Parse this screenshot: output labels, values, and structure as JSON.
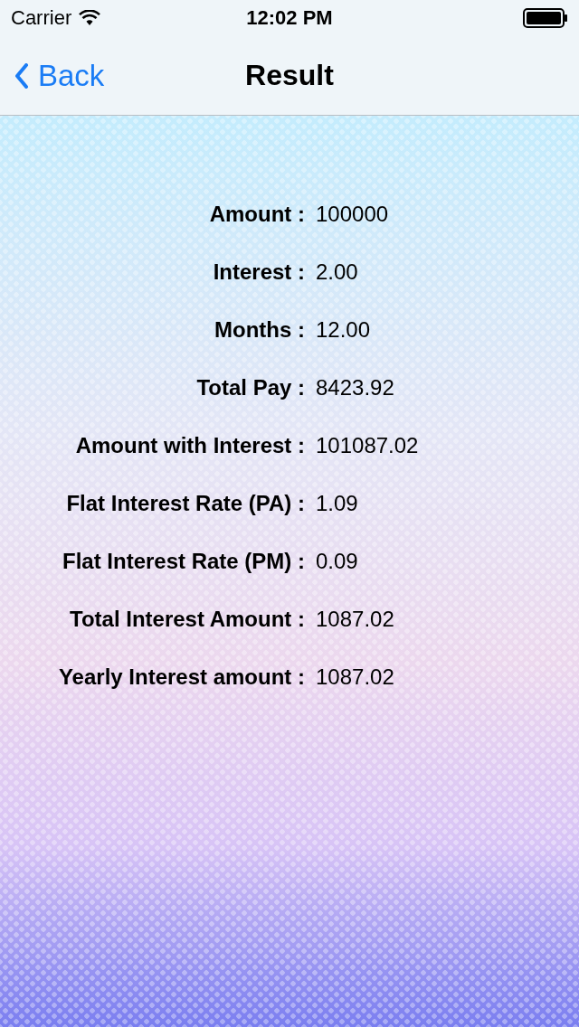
{
  "status_bar": {
    "carrier": "Carrier",
    "time": "12:02 PM"
  },
  "nav_bar": {
    "back": "Back",
    "title": "Result"
  },
  "results": [
    {
      "label": "Amount :",
      "value": "100000"
    },
    {
      "label": "Interest :",
      "value": "2.00"
    },
    {
      "label": "Months :",
      "value": "12.00"
    },
    {
      "label": "Total Pay :",
      "value": "8423.92"
    },
    {
      "label": "Amount with Interest :",
      "value": "101087.02"
    },
    {
      "label": "Flat Interest Rate (PA) :",
      "value": "1.09"
    },
    {
      "label": "Flat Interest Rate (PM) :",
      "value": "0.09"
    },
    {
      "label": "Total Interest Amount :",
      "value": "1087.02"
    },
    {
      "label": "Yearly Interest amount :",
      "value": "1087.02"
    }
  ]
}
